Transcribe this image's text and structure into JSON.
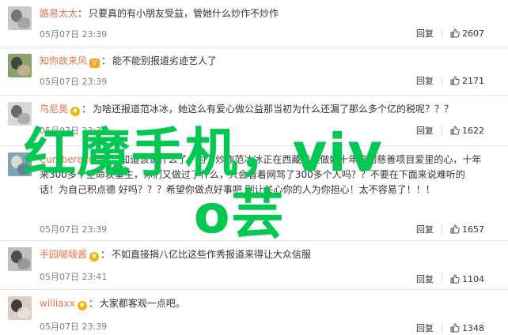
{
  "colors": {
    "username": "#eb7350",
    "meta": "#808080",
    "watermark": "#00c853",
    "divider": "#e4e4e4"
  },
  "comments": [
    {
      "username": "路易太太",
      "badge": "",
      "text": "只要真的有小朋友受益，管她什么炒作不炒作",
      "time": "05月07日 23:39",
      "reply": "回复",
      "likes": "2607"
    },
    {
      "username": "知你故来风",
      "badge": "vip",
      "text": "能不能别报道劣迹艺人了",
      "time": "05月07日 23:39",
      "reply": "回复",
      "likes": "2171"
    },
    {
      "username": "乌尼奥",
      "badge": "verified",
      "text": "为啥还报道范冰冰，她这么有爱心做公益那当初为什么还漏了那么多个亿的税呢？？？",
      "time": "05月07日 23:39",
      "reply": "回复",
      "likes": "1622"
    },
    {
      "username": "Cumberexmen",
      "badge": "",
      "text": "知道该说什么了，为了炒作范冰冰正在西藏继续做她十年来的慈善项目爱里的心，十年来300多个生命获重生，你们又做过了什么，只会看着网骂了300多个人吗？？不要在下面来说难听的话！为自己积点德 好吗？？？希望你做点好事吧 别让关心你的人为你担心！太不容易了！！！",
      "time": "05月07日 23:39",
      "reply": "回复",
      "likes": "1657"
    },
    {
      "username": "手园啵啵酱",
      "badge": "verified",
      "text": "不如直接捐八亿比这些作秀报道来得让大众信服",
      "time": "05月07日 23:41",
      "reply": "回复",
      "likes": "1104"
    },
    {
      "username": "williaxx",
      "badge": "verified",
      "text": "大家都客观一点吧。",
      "time": "05月07日 23:39",
      "reply": "回复",
      "likes": "1348"
    }
  ],
  "watermark": {
    "line1": "红魔手机，viv",
    "line2": "o芸"
  }
}
